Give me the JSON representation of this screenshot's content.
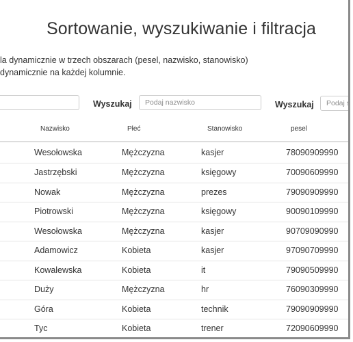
{
  "page": {
    "title": "Sortowanie, wyszukiwanie i filtracja",
    "description_line1": "la dynamicznie w trzech obszarach (pesel, nazwisko, stanowisko)",
    "description_line2": "dynamicznie na każdej kolumnie."
  },
  "search": {
    "label_1": "Wyszukaj",
    "label_2": "Wyszukaj",
    "input_1_placeholder": "",
    "input_2_placeholder": "Podaj nazwisko",
    "input_3_placeholder": "Podaj st"
  },
  "table": {
    "columns": [
      "Nazwisko",
      "Płeć",
      "Stanowisko",
      "pesel"
    ],
    "rows": [
      [
        "Wesołowska",
        "Mężczyzna",
        "kasjer",
        "78090909990"
      ],
      [
        "Jastrzębski",
        "Mężczyzna",
        "księgowy",
        "70090609990"
      ],
      [
        "Nowak",
        "Mężczyzna",
        "prezes",
        "79090909990"
      ],
      [
        "Piotrowski",
        "Mężczyzna",
        "księgowy",
        "90090109990"
      ],
      [
        "Wesołowska",
        "Mężczyzna",
        "kasjer",
        "90709090990"
      ],
      [
        "Adamowicz",
        "Kobieta",
        "kasjer",
        "97090709990"
      ],
      [
        "Kowalewska",
        "Kobieta",
        "it",
        "79090509990"
      ],
      [
        "Duży",
        "Mężczyzna",
        "hr",
        "76090309990"
      ],
      [
        "Góra",
        "Kobieta",
        "technik",
        "79090909990"
      ],
      [
        "Tyc",
        "Kobieta",
        "trener",
        "72090609990"
      ]
    ]
  }
}
